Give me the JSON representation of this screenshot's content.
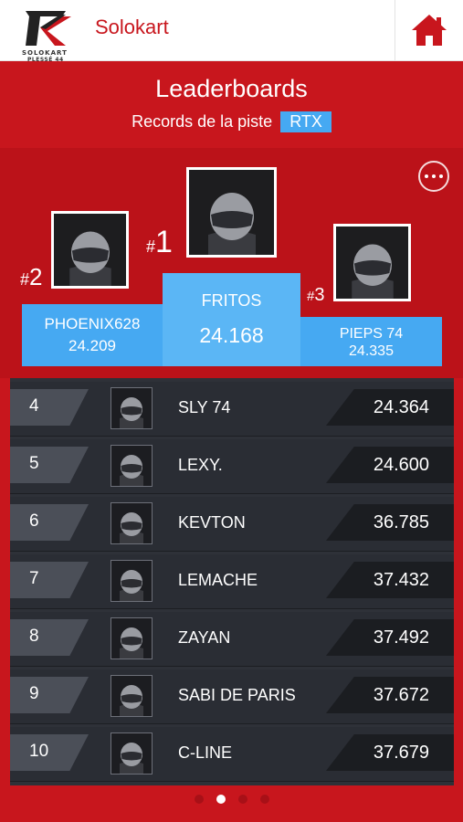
{
  "app": {
    "logo_text": "SOLOKART",
    "logo_sub": "PLESSÉ 44",
    "title": "Solokart"
  },
  "header": {
    "title": "Leaderboards",
    "subtitle": "Records de la piste",
    "track_badge": "RTX"
  },
  "podium": {
    "first": {
      "rank_hash": "#",
      "rank": "1",
      "name": "FRITOS",
      "time": "24.168"
    },
    "second": {
      "rank_hash": "#",
      "rank": "2",
      "name": "PHOENIX628",
      "time": "24.209"
    },
    "third": {
      "rank_hash": "#",
      "rank": "3",
      "name": "PIEPS 74",
      "time": "24.335"
    }
  },
  "rows": [
    {
      "rank": "4",
      "name": "SLY 74",
      "time": "24.364"
    },
    {
      "rank": "5",
      "name": "LEXY.",
      "time": "24.600"
    },
    {
      "rank": "6",
      "name": "KEVTON",
      "time": "36.785"
    },
    {
      "rank": "7",
      "name": "LEMACHE",
      "time": "37.432"
    },
    {
      "rank": "8",
      "name": "ZAYAN",
      "time": "37.492"
    },
    {
      "rank": "9",
      "name": "SABI DE PARIS",
      "time": "37.672"
    },
    {
      "rank": "10",
      "name": "C-LINE",
      "time": "37.679"
    }
  ],
  "pagination": {
    "pages": 4,
    "active_index": 1
  },
  "colors": {
    "brand_red": "#c8161d",
    "accent_blue": "#46a9f2",
    "list_bg": "#2a2d34"
  },
  "icons": [
    "home-icon",
    "more-options-icon",
    "helmet-avatar-icon"
  ]
}
